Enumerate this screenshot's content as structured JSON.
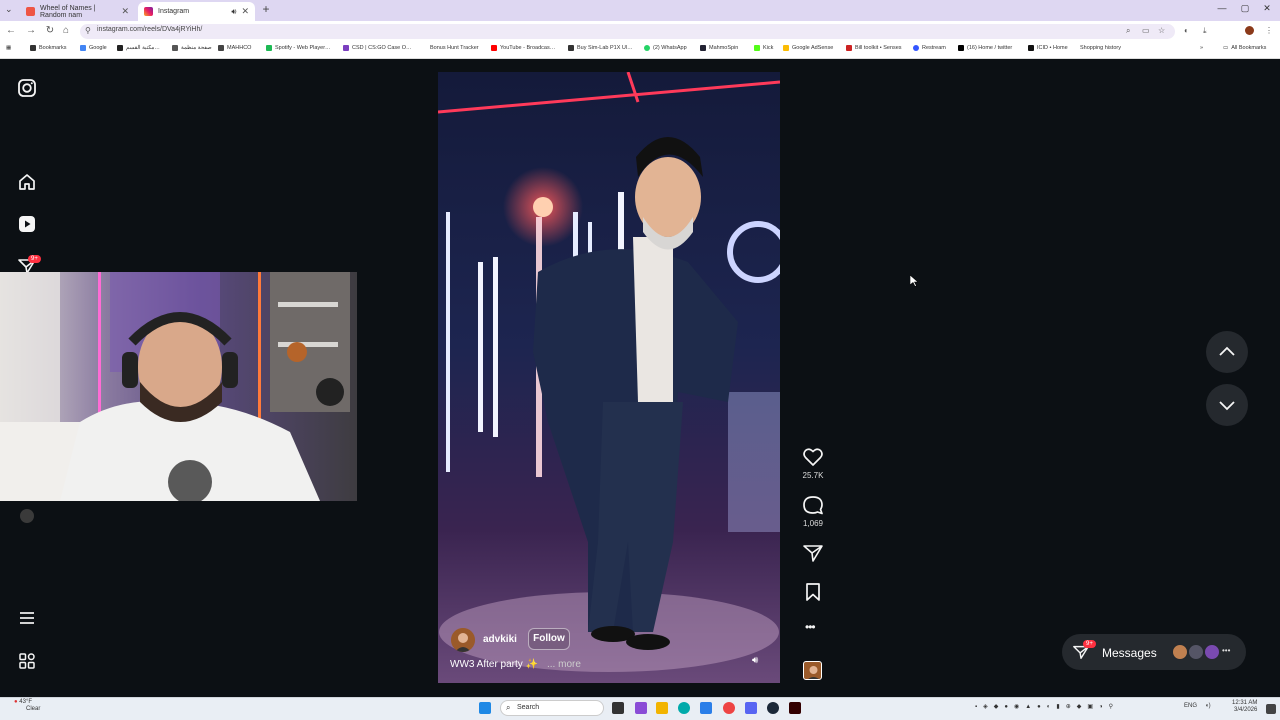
{
  "browser": {
    "tabs": [
      {
        "title": "Wheel of Names | Random nam",
        "active": false
      },
      {
        "title": "Instagram",
        "active": true
      }
    ],
    "url": "instagram.com/reels/DVa4jRYiHh/",
    "bookmarks": [
      "Bookmarks",
      "Google",
      "مكتبة القسم…",
      "صفحة منظمة",
      "MAHHCO",
      "Spotify - Web Player…",
      "CSD | CS:GO Case O…",
      "Bonus Hunt Tracker",
      "YouTube - Broadcas…",
      "Buy Sim-Lab P1X Ul…",
      "(2) WhatsApp",
      "MahmoSpin",
      "Kick",
      "Google AdSense",
      "Bill toolkit • Senses",
      "Restream",
      "(16) Home / twitter",
      "ICID • Home",
      "Shopping history"
    ],
    "all_bookmarks": "All Bookmarks"
  },
  "sidebar": {
    "notification_badge": "9+"
  },
  "reel": {
    "username": "advkiki",
    "follow_label": "Follow",
    "caption": "WW3 After party",
    "more_label": "... more",
    "likes": "25.7K",
    "comments": "1,069"
  },
  "messages": {
    "label": "Messages",
    "badge": "9+"
  },
  "taskbar": {
    "weather_temp": "43°F",
    "weather_desc": "Clear",
    "search_placeholder": "Search",
    "lang": "ENG",
    "time": "12:31 AM",
    "date": "3/4/2026"
  },
  "colors": {
    "ig_background": "#0c1014",
    "badge_red": "#ff3040",
    "tab_strip": "#ded7f2"
  }
}
